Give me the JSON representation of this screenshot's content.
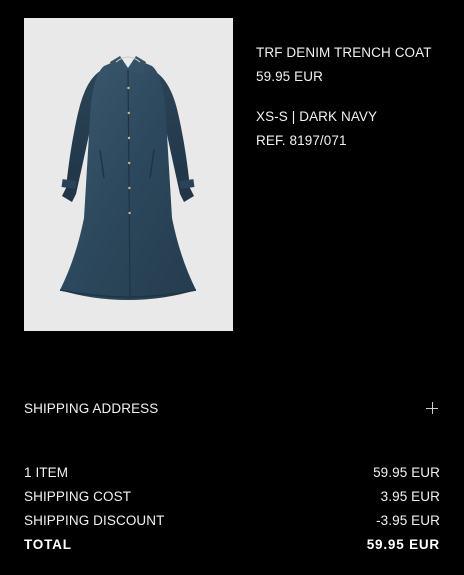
{
  "product": {
    "name": "TRF DENIM TRENCH COAT",
    "price": "59.95 EUR",
    "size_color": "XS-S | DARK NAVY",
    "reference": "REF. 8197/071",
    "image_icon": "denim-trench-coat-photo"
  },
  "shipping": {
    "label": "SHIPPING ADDRESS",
    "expand_icon": "plus-icon"
  },
  "summary": {
    "items_label": "1 ITEM",
    "items_value": "59.95 EUR",
    "cost_label": "SHIPPING COST",
    "cost_value": "3.95 EUR",
    "discount_label": "SHIPPING DISCOUNT",
    "discount_value": "-3.95 EUR",
    "total_label": "TOTAL",
    "total_value": "59.95 EUR"
  },
  "colors": {
    "background": "#000000",
    "text": "#f2f2f2",
    "image_bg": "#e9e9ea",
    "denim": "#2f4a5e"
  }
}
